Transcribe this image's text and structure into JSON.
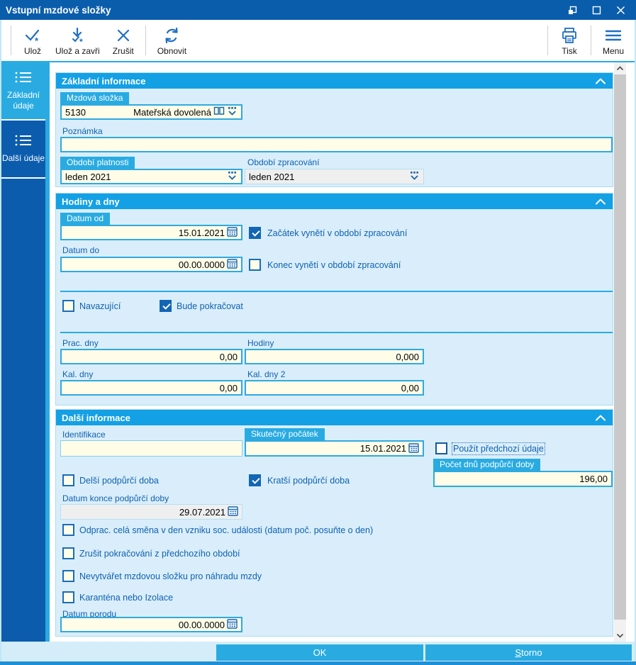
{
  "window": {
    "title": "Vstupní mzdové složky"
  },
  "toolbar": {
    "save": "Ulož",
    "save_close": "Ulož a zavři",
    "cancel": "Zrušit",
    "refresh": "Obnovit",
    "print": "Tisk",
    "menu": "Menu"
  },
  "sidebar": {
    "items": [
      {
        "label": "Základní údaje",
        "active": true
      },
      {
        "label": "Další údaje",
        "active": false
      }
    ]
  },
  "sections": {
    "basic": {
      "title": "Základní informace",
      "wage_component": {
        "label": "Mzdová složka",
        "code": "5130",
        "name": "Mateřská dovolená"
      },
      "note": {
        "label": "Poznámka",
        "value": ""
      },
      "validity_period": {
        "label": "Období platnosti",
        "value": "leden 2021"
      },
      "processing_period": {
        "label": "Období zpracování",
        "value": "leden 2021"
      }
    },
    "hours_days": {
      "title": "Hodiny a dny",
      "date_from": {
        "label": "Datum od",
        "value": "15.01.2021"
      },
      "start_exempt": {
        "label": "Začátek vynětí v období zpracování",
        "checked": true
      },
      "date_to": {
        "label": "Datum do",
        "value": "00.00.0000"
      },
      "end_exempt": {
        "label": "Konec vynětí v období zpracování",
        "checked": false
      },
      "continuing": {
        "label": "Navazující",
        "checked": false
      },
      "will_continue": {
        "label": "Bude pokračovat",
        "checked": true
      },
      "work_days": {
        "label": "Prac. dny",
        "value": "0,00"
      },
      "hours": {
        "label": "Hodiny",
        "value": "0,000"
      },
      "cal_days": {
        "label": "Kal. dny",
        "value": "0,00"
      },
      "cal_days_2": {
        "label": "Kal. dny 2",
        "value": "0,00"
      }
    },
    "other": {
      "title": "Další informace",
      "identification": {
        "label": "Identifikace",
        "value": ""
      },
      "actual_start": {
        "label": "Skutečný počátek",
        "value": "15.01.2021"
      },
      "use_previous": {
        "label": "Použít předchozí údaje",
        "checked": false
      },
      "longer_support": {
        "label": "Delší podpůrčí doba",
        "checked": false
      },
      "shorter_support": {
        "label": "Kratší podpůrčí doba",
        "checked": true
      },
      "support_days": {
        "label": "Počet dnů podpůrčí doby",
        "value": "196,00"
      },
      "support_end": {
        "label": "Datum konce podpůrčí doby",
        "value": "29.07.2021"
      },
      "full_shift": {
        "label": "Odprac. celá směna v den vzniku soc. události (datum poč. posuňte o den)",
        "checked": false
      },
      "cancel_continuation": {
        "label": "Zrušit pokračování z předchozího období",
        "checked": false
      },
      "no_wage_component": {
        "label": "Nevytvářet mzdovou složku pro náhradu mzdy",
        "checked": false
      },
      "quarantine": {
        "label": "Karanténa nebo Izolace",
        "checked": false
      },
      "birth_date": {
        "label": "Datum porodu",
        "value": "00.00.0000"
      }
    }
  },
  "footer": {
    "ok": "OK",
    "storno": "Storno"
  },
  "colors": {
    "titlebar": "#0a5dab",
    "accent": "#29abe2",
    "section_bg": "#d9eefa",
    "field_bg": "#fffde8",
    "sidebar": "#0b5cad",
    "disabled_bg": "#efefef"
  }
}
